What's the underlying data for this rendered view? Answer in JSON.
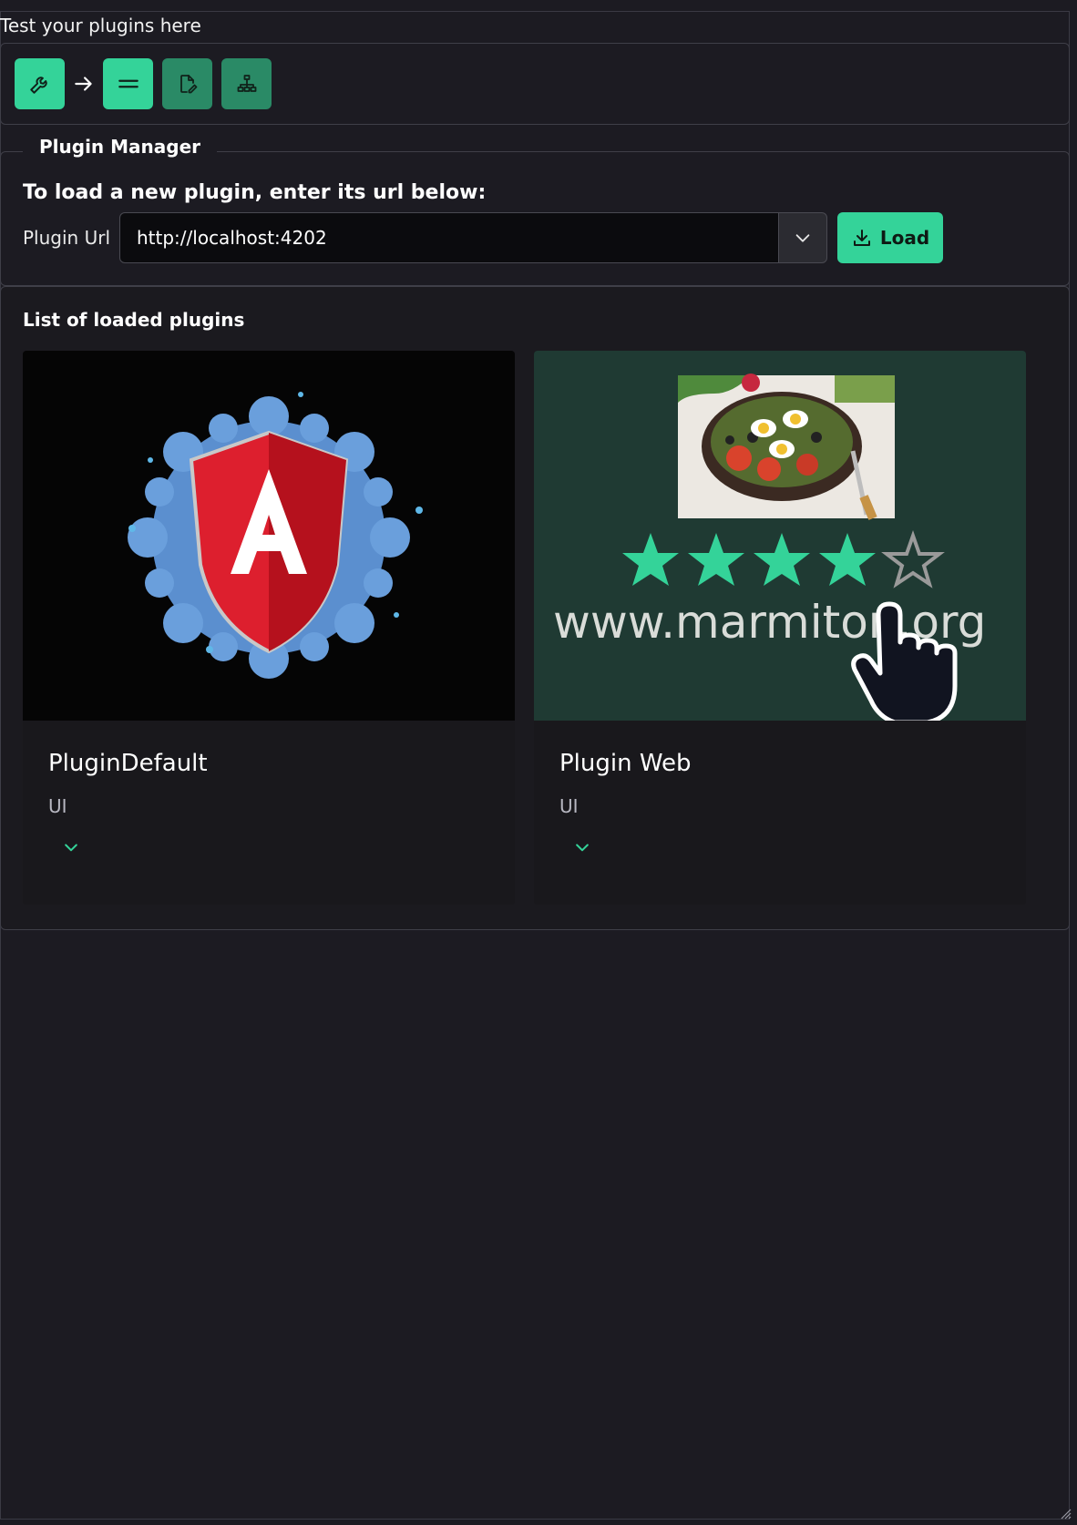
{
  "header": {
    "title": "Test your plugins here"
  },
  "toolbar": {
    "buttons": [
      {
        "icon": "wrench-icon"
      },
      {
        "icon": "equals-icon"
      },
      {
        "icon": "file-edit-icon"
      },
      {
        "icon": "sitemap-icon"
      }
    ]
  },
  "plugin_manager": {
    "legend": "Plugin Manager",
    "heading": "To load a new plugin, enter its url below:",
    "url_label": "Plugin Url",
    "url_value": "http://localhost:4202",
    "load_label": "Load"
  },
  "plugins_list": {
    "title": "List of loaded plugins",
    "cards": [
      {
        "name": "PluginDefault",
        "type": "UI",
        "image": "angular-shield-logo"
      },
      {
        "name": "Plugin Web",
        "type": "UI",
        "image": "marmiton-preview",
        "image_text": "www.marmiton.org",
        "rating": 4,
        "rating_max": 5
      }
    ]
  },
  "colors": {
    "background": "#1c1b22",
    "accent": "#34d399",
    "accent_dim": "#2a8a66",
    "card_image_dark": "#050505",
    "card_image_green": "#1f3a33"
  }
}
